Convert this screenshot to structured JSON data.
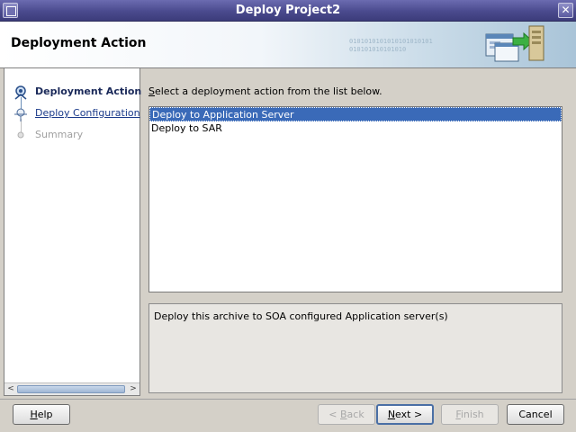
{
  "window": {
    "title": "Deploy Project2"
  },
  "header": {
    "title": "Deployment Action",
    "binary_text": "0101010101010101010101 010101010101010"
  },
  "nav": {
    "items": [
      {
        "label": "Deployment Action",
        "state": "active"
      },
      {
        "label": "Deploy Configuration",
        "state": "link"
      },
      {
        "label": "Summary",
        "state": "disabled"
      }
    ]
  },
  "main": {
    "instruction_mnemonic": "S",
    "instruction_rest": "elect a deployment action from the list below.",
    "actions": [
      {
        "label": "Deploy to Application Server",
        "selected": true
      },
      {
        "label": "Deploy to SAR",
        "selected": false
      }
    ],
    "description": "Deploy this archive to SOA configured Application server(s)"
  },
  "buttons": {
    "help": {
      "mnemonic": "H",
      "rest": "elp"
    },
    "back": {
      "prefix": "< ",
      "mnemonic": "B",
      "rest": "ack"
    },
    "next": {
      "mnemonic": "N",
      "rest": "ext >"
    },
    "finish": {
      "mnemonic": "F",
      "rest": "inish"
    },
    "cancel": {
      "label": "Cancel"
    }
  },
  "colors": {
    "selection": "#3a6ab8",
    "titlebar": "#4a4a8e",
    "link": "#1a3a8a"
  }
}
